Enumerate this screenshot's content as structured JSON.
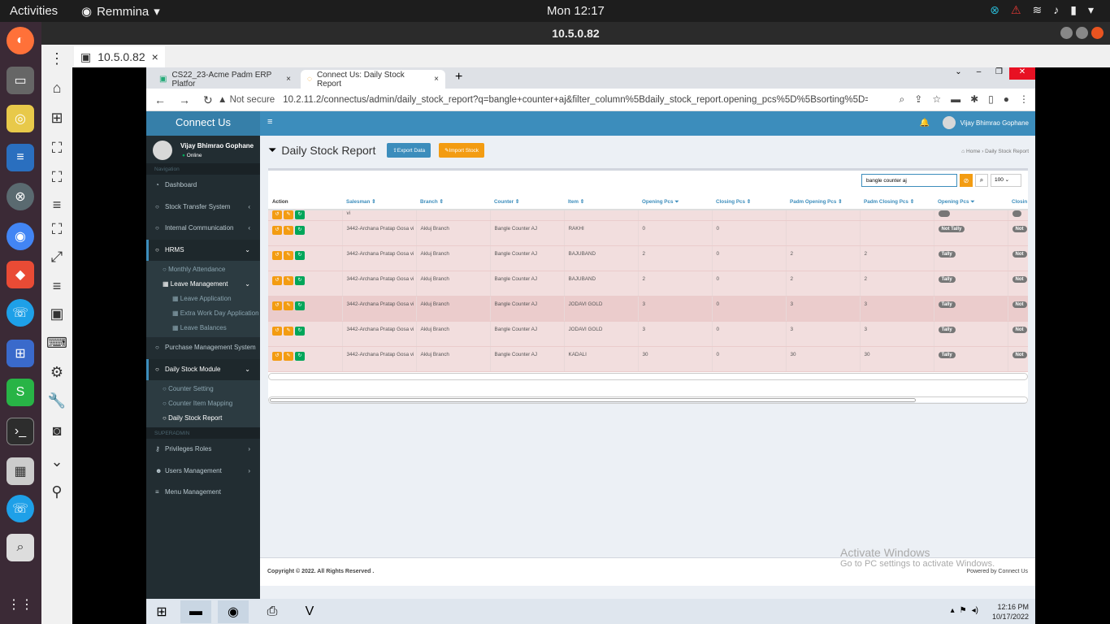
{
  "os": {
    "activities": "Activities",
    "app_name": "Remmina",
    "clock": "Mon 12:17"
  },
  "remmina": {
    "title": "10.5.0.82",
    "tab_label": "10.5.0.82"
  },
  "browser": {
    "tabs": [
      {
        "label": "CS22_23-Acme Padm ERP Platfor"
      },
      {
        "label": "Connect Us: Daily Stock Report"
      }
    ],
    "not_secure": "Not secure",
    "url": "10.2.11.2/connectus/admin/daily_stock_report?q=bangle+counter+aj&filter_column%5Bdaily_stock_report.opening_pcs%5D%5Bsorting%5D=asc&limi..."
  },
  "sidebar": {
    "logo": "Connect Us",
    "user_name": "Vijay Bhimrao Gophane",
    "status": "Online",
    "nav_header": "Navigation",
    "superadmin_header": "SUPERADMIN",
    "items": {
      "dashboard": "Dashboard",
      "stock_transfer": "Stock Transfer System",
      "internal_comm": "Internal Communication",
      "hrms": "HRMS",
      "monthly_attendance": "Monthly Attendance",
      "leave_management": "Leave Management",
      "leave_application": "Leave Application",
      "extra_work": "Extra Work Day Application",
      "leave_balances": "Leave Balances",
      "purchase": "Purchase Management System",
      "daily_stock": "Daily Stock Module",
      "counter_setting": "Counter Setting",
      "counter_item_mapping": "Counter Item Mapping",
      "daily_stock_report": "Daily Stock Report",
      "privileges": "Privileges Roles",
      "users": "Users Management",
      "menu": "Menu Management"
    }
  },
  "header": {
    "user_name": "Vijay Bhimrao Gophane"
  },
  "content": {
    "title": "Daily Stock Report",
    "export_label": "Export Data",
    "import_label": "Import Stock",
    "breadcrumb_home": "Home",
    "breadcrumb_current": "Daily Stock Report",
    "search_value": "bangle counter aj",
    "page_size": "100"
  },
  "table": {
    "columns": [
      "Action",
      "Salesman",
      "Branch",
      "Counter",
      "Item",
      "Opening Pcs",
      "Closing Pcs",
      "Padm Opening Pcs",
      "Padm Closing Pcs",
      "Opening Pcs",
      "Closin"
    ],
    "partial_row": {
      "salesman": "vi"
    },
    "rows": [
      {
        "salesman": "3442-Archana Pratap Gosa vi",
        "branch": "Akluj Branch",
        "counter": "Bangle Counter AJ",
        "item": "RAKHI",
        "opening": "0",
        "closing": "0",
        "padm_opening": "",
        "padm_closing": "",
        "status": "Not Tally",
        "status2": "Not"
      },
      {
        "salesman": "3442-Archana Pratap Gosa vi",
        "branch": "Akluj Branch",
        "counter": "Bangle Counter AJ",
        "item": "BAJUBAND",
        "opening": "2",
        "closing": "0",
        "padm_opening": "2",
        "padm_closing": "2",
        "status": "Tally",
        "status2": "Not"
      },
      {
        "salesman": "3442-Archana Pratap Gosa vi",
        "branch": "Akluj Branch",
        "counter": "Bangle Counter AJ",
        "item": "BAJUBAND",
        "opening": "2",
        "closing": "0",
        "padm_opening": "2",
        "padm_closing": "2",
        "status": "Tally",
        "status2": "Not"
      },
      {
        "salesman": "3442-Archana Pratap Gosa vi",
        "branch": "Akluj Branch",
        "counter": "Bangle Counter AJ",
        "item": "JODAVI GOLD",
        "opening": "3",
        "closing": "0",
        "padm_opening": "3",
        "padm_closing": "3",
        "status": "Tally",
        "status2": "Not"
      },
      {
        "salesman": "3442-Archana Pratap Gosa vi",
        "branch": "Akluj Branch",
        "counter": "Bangle Counter AJ",
        "item": "JODAVI GOLD",
        "opening": "3",
        "closing": "0",
        "padm_opening": "3",
        "padm_closing": "3",
        "status": "Tally",
        "status2": "Not"
      },
      {
        "salesman": "3442-Archana Pratap Gosa vi",
        "branch": "Akluj Branch",
        "counter": "Bangle Counter AJ",
        "item": "KADALI",
        "opening": "30",
        "closing": "0",
        "padm_opening": "30",
        "padm_closing": "30",
        "status": "Tally",
        "status2": "Not"
      }
    ]
  },
  "footer": {
    "copyright": "Copyright © 2022. All Rights Reserved .",
    "powered": "Powered by Connect Us"
  },
  "watermark": {
    "line1": "Activate Windows",
    "line2": "Go to PC settings to activate Windows."
  },
  "taskbar": {
    "time": "12:16 PM",
    "date": "10/17/2022"
  },
  "colors": {
    "sidebar_bg": "#222d32",
    "header_blue": "#3c8dbc",
    "danger_row": "#f2dede",
    "orange": "#f39c12",
    "green": "#00a65a"
  }
}
